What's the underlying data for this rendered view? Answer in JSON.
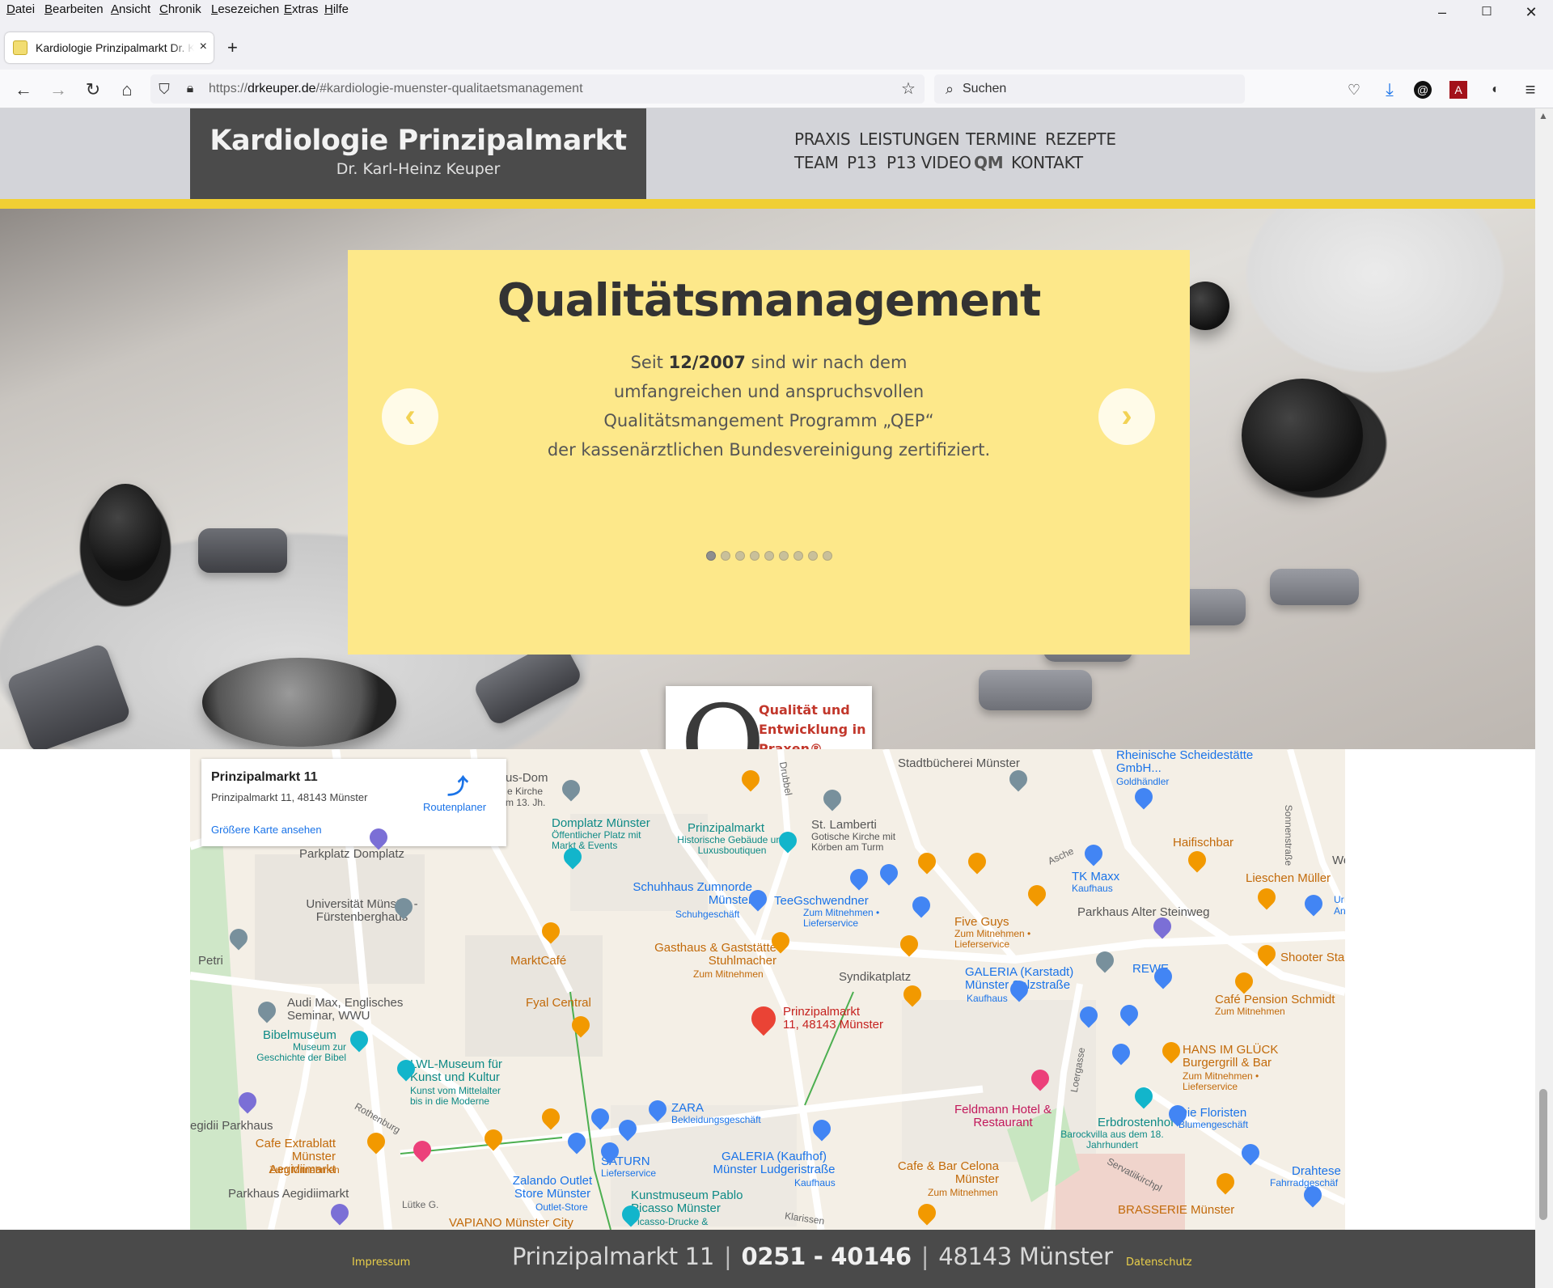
{
  "menubar": {
    "items": [
      "Datei",
      "Bearbeiten",
      "Ansicht",
      "Chronik",
      "Lesezeichen",
      "Extras",
      "Hilfe"
    ]
  },
  "window_controls": {
    "minimize": "–",
    "maximize": "☐",
    "close": "✕"
  },
  "tab": {
    "title": "Kardiologie Prinzipalmarkt Dr. K",
    "close": "×",
    "new_tab": "+"
  },
  "url": {
    "scheme": "https://",
    "domain": "drkeuper.de",
    "path": "/#kardiologie-muenster-qualitaetsmanagement"
  },
  "search": {
    "placeholder": "Suchen"
  },
  "site": {
    "brand_title": "Kardiologie Prinzipalmarkt",
    "brand_subtitle": "Dr. Karl-Heinz Keuper",
    "nav": [
      "PRAXIS",
      "LEISTUNGEN",
      "TERMINE",
      "REZEPTE",
      "TEAM",
      "P13",
      "P13 VIDEO",
      "QM",
      "KONTAKT"
    ],
    "active_nav": "QM",
    "accent_color": "#f0cf34"
  },
  "slider": {
    "heading": "Qualitätsmanagement",
    "text_prefix": "Seit ",
    "text_bold": "12/2007",
    "text_line1_rest": " sind wir nach dem",
    "text_line2": "umfangreichen und anspruchsvollen",
    "text_line3": "Qualitätsmangement Programm „QEP“",
    "text_line4": "der kassenärztlichen Bundesvereinigung zertifiziert.",
    "prev_label": "‹",
    "next_label": "›",
    "dot_count": 9,
    "active_dot": 1
  },
  "qep_logo": {
    "letter": "Q",
    "text": "Qualität und Entwicklung in Praxen®"
  },
  "map": {
    "card_title": "Prinzipalmarkt 11",
    "card_address": "Prinzipalmarkt 11, 48143 Münster",
    "card_link": "Größere Karte ansehen",
    "route_label": "Routenplaner",
    "marker_label_1": "Prinzipalmarkt",
    "marker_label_2": "11, 48143 Münster",
    "labels": [
      "Stadtbücherei Münster",
      "Rheinische Scheidestätte GmbH...",
      "Goldhändler",
      "Domplatz Münster",
      "Öffentlicher Platz mit Markt & Events",
      "Prinzipalmarkt",
      "Historische Gebäude und Luxusboutiquen",
      "St. Lamberti",
      "Gotische Kirche mit Körben am Turm",
      "Haifischbar",
      "TK Maxx",
      "Kaufhaus",
      "Lieschen Müller",
      "Parkplatz Domplatz",
      "Universität Münster - Fürstenberghaus",
      "Schuhhaus Zumnorde Münster",
      "Schuhgeschäft",
      "TeeGschwendner",
      "Zum Mitnehmen • Lieferservice",
      "Parkhaus Alter Steinweg",
      "Five Guys",
      "Zum Mitnehmen • Lieferservice",
      "MarktCafé",
      "Gasthaus & Gaststätte Stuhlmacher",
      "Zum Mitnehmen",
      "Syndikatplatz",
      "GALERIA (Karstadt) Münster Salzstraße",
      "Kaufhaus",
      "REWE",
      "Shooter Sta",
      "Café Pension Schmidt",
      "Zum Mitnehmen",
      "Fyal Central",
      "Audi Max, Englisches Seminar, WWU",
      "Bibelmuseum",
      "Museum zur Geschichte der Bibel",
      "LWL-Museum für Kunst und Kultur",
      "Kunst vom Mittelalter bis in die Moderne",
      "HANS IM GLÜCK Burgergrill & Bar",
      "Zum Mitnehmen • Lieferservice",
      "ZARA",
      "Bekleidungsgeschäft",
      "Feldmann Hotel & Restaurant",
      "Erbdrostenhof",
      "Barockvilla aus dem 18. Jahrhundert",
      "Die Floristen",
      "Blumengeschäft",
      "egidii Parkhaus",
      "Cafe Extrablatt Münster Aegidiimarkt",
      "Zum Mitnehmen",
      "SATURN",
      "Lieferservice",
      "GALERIA (Kaufhof) Münster Ludgeristraße",
      "Kaufhaus",
      "Cafe & Bar Celona Münster",
      "Zum Mitnehmen",
      "Parkhaus Aegidiimarkt",
      "Zalando Outlet Store Münster",
      "Outlet-Store",
      "Kunstmuseum Pablo Picasso Münster",
      "Picasso-Drucke &",
      "VAPIANO Münster City",
      "BRASSERIE Münster",
      "Drahtese",
      "Fahrradgeschäf",
      "Petri",
      "Drubbel",
      "Asche",
      "Sonnenstraße",
      "Loergasse",
      "Rothenburg",
      "Servatiikirchpl",
      "Klarissen",
      "Lütke G.",
      "us-Dom",
      "e Kirche",
      "m 13. Jh.",
      "We",
      "An",
      "Ur"
    ]
  },
  "footer": {
    "impressum": "Impressum",
    "street": "Prinzipalmarkt 11",
    "phone": "0251 - 40146",
    "city": "48143 Münster",
    "separator": "|",
    "datenschutz": "Datenschutz"
  }
}
